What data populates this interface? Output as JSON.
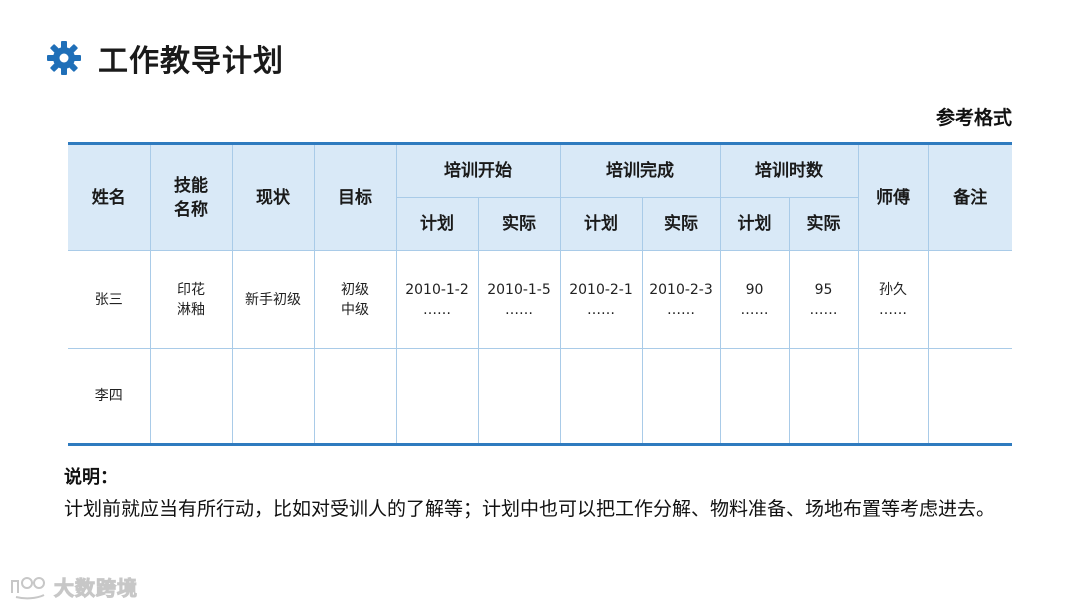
{
  "header": {
    "title": "工作教导计划",
    "reference_label": "参考格式",
    "icon": "gear-icon",
    "accent_color": "#1f6fb8"
  },
  "table": {
    "headers": {
      "name": "姓名",
      "skill_line1": "技能",
      "skill_line2": "名称",
      "status": "现状",
      "goal": "目标",
      "train_start": "培训开始",
      "train_complete": "培训完成",
      "train_hours": "培训时数",
      "mentor": "师傅",
      "remarks": "备注",
      "sub": [
        "计划",
        "实际",
        "计划",
        "实际",
        "计划",
        "实际"
      ]
    },
    "rows": [
      {
        "name": "张三",
        "skill_line1": "印花",
        "skill_line2": "淋釉",
        "status": "新手初级",
        "goal_line1": "初级",
        "goal_line2": "中级",
        "start_plan": "2010-1-2",
        "start_actual": "2010-1-5",
        "complete_plan": "2010-2-1",
        "complete_actual": "2010-2-3",
        "hours_plan": "90",
        "hours_actual": "95",
        "mentor": "孙久",
        "ellipsis": "……",
        "remarks": ""
      },
      {
        "name": "李四"
      }
    ],
    "header_bg": "#d9e9f7",
    "border_color": "#2f7bbf"
  },
  "note": {
    "heading": "说明：",
    "body": "计划前就应当有所行动，比如对受训人的了解等；计划中也可以把工作分解、物料准备、场地布置等考虑进去。"
  },
  "watermark": {
    "text": "大数跨境"
  }
}
